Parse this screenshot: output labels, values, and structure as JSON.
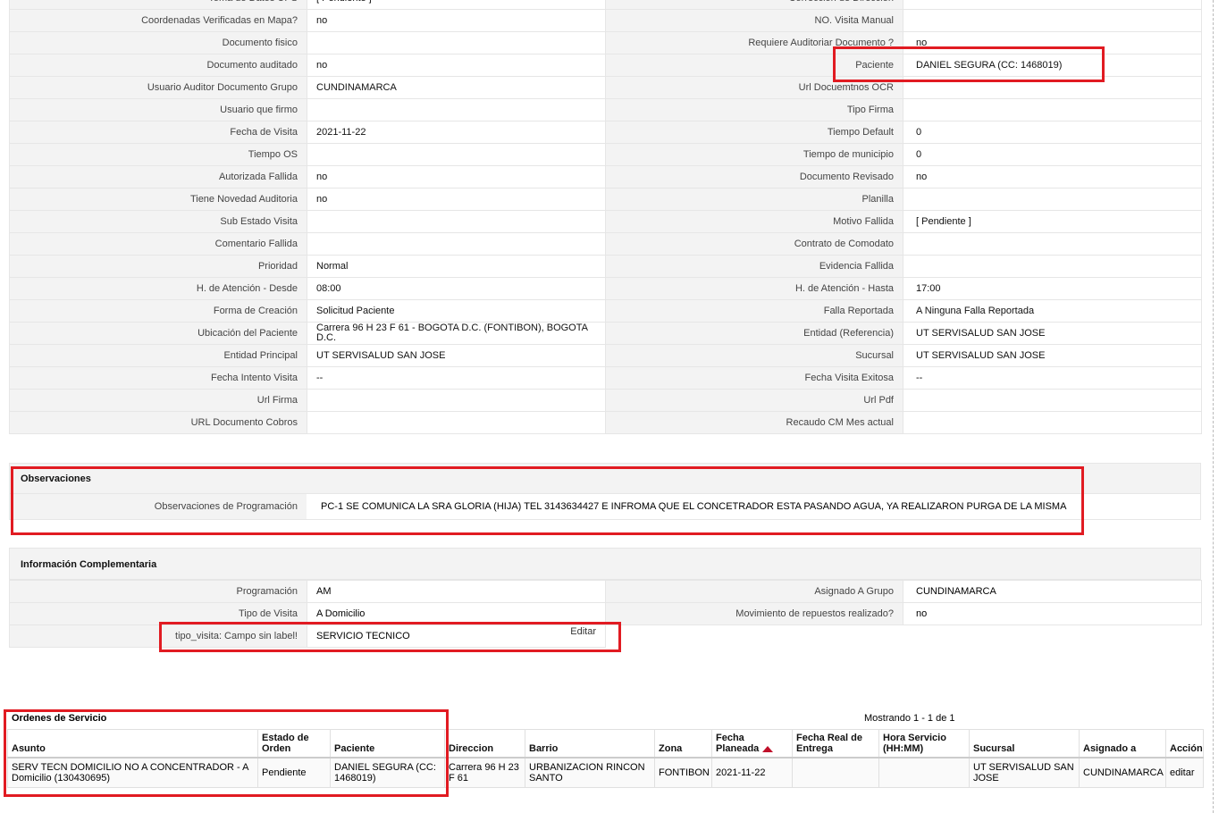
{
  "detail_rows": [
    {
      "l1": "Toma de Datos UPS",
      "v1": "[ Pendiente ]",
      "l2": "Corrección de Dirección",
      "v2": ""
    },
    {
      "l1": "Coordenadas Verificadas en Mapa?",
      "v1": "no",
      "l2": "NO. Visita Manual",
      "v2": ""
    },
    {
      "l1": "Documento fisico",
      "v1": "",
      "l2": "Requiere Auditoriar Documento ?",
      "v2": "no"
    },
    {
      "l1": "Documento auditado",
      "v1": "no",
      "l2": "Paciente",
      "v2": "DANIEL SEGURA (CC: 1468019)"
    },
    {
      "l1": "Usuario Auditor Documento Grupo",
      "v1": "CUNDINAMARCA",
      "l2": "Url Docuemtnos OCR",
      "v2": ""
    },
    {
      "l1": "Usuario que firmo",
      "v1": "",
      "l2": "Tipo Firma",
      "v2": ""
    },
    {
      "l1": "Fecha de Visita",
      "v1": "2021-11-22",
      "l2": "Tiempo Default",
      "v2": "0"
    },
    {
      "l1": "Tiempo OS",
      "v1": "",
      "l2": "Tiempo de municipio",
      "v2": "0"
    },
    {
      "l1": "Autorizada Fallida",
      "v1": "no",
      "l2": "Documento Revisado",
      "v2": "no"
    },
    {
      "l1": "Tiene Novedad Auditoria",
      "v1": "no",
      "l2": "Planilla",
      "v2": ""
    },
    {
      "l1": "Sub Estado Visita",
      "v1": "",
      "l2": "Motivo Fallida",
      "v2": "[ Pendiente ]"
    },
    {
      "l1": "Comentario Fallida",
      "v1": "",
      "l2": "Contrato de Comodato",
      "v2": ""
    },
    {
      "l1": "Prioridad",
      "v1": "Normal",
      "l2": "Evidencia Fallida",
      "v2": ""
    },
    {
      "l1": "H. de Atención - Desde",
      "v1": "08:00",
      "l2": "H. de Atención - Hasta",
      "v2": "17:00"
    },
    {
      "l1": "Forma de Creación",
      "v1": "Solicitud Paciente",
      "l2": "Falla Reportada",
      "v2": "A Ninguna Falla Reportada"
    },
    {
      "l1": "Ubicación del Paciente",
      "v1": "Carrera 96 H 23 F 61 - BOGOTA D.C. (FONTIBON), BOGOTA D.C.",
      "l2": "Entidad (Referencia)",
      "v2": "UT SERVISALUD SAN JOSE"
    },
    {
      "l1": "Entidad Principal",
      "v1": "UT SERVISALUD SAN JOSE",
      "l2": "Sucursal",
      "v2": "UT SERVISALUD SAN JOSE"
    },
    {
      "l1": "Fecha Intento Visita",
      "v1": "--",
      "l2": "Fecha Visita Exitosa",
      "v2": "--"
    },
    {
      "l1": "Url Firma",
      "v1": "",
      "l2": "Url Pdf",
      "v2": ""
    },
    {
      "l1": "URL Documento Cobros",
      "v1": "",
      "l2": "Recaudo CM Mes actual",
      "v2": ""
    }
  ],
  "observaciones": {
    "title": "Observaciones",
    "label": "Observaciones de Programación",
    "value": "PC-1 SE COMUNICA LA SRA GLORIA (HIJA) TEL 3143634427 E INFROMA QUE EL CONCETRADOR ESTA PASANDO AGUA, YA REALIZARON PURGA DE LA MISMA"
  },
  "complementaria": {
    "title": "Información Complementaria",
    "rows": [
      {
        "l1": "Programación",
        "v1": "AM",
        "l2": "Asignado A Grupo",
        "v2": "CUNDINAMARCA"
      },
      {
        "l1": "Tipo de Visita",
        "v1": "A Domicilio",
        "l2": "Movimiento de repuestos realizado?",
        "v2": "no"
      }
    ],
    "tipo_visita_label": "tipo_visita: Campo sin label!",
    "tipo_visita_value": "SERVICIO TECNICO",
    "edit_label": "Editar"
  },
  "ordenes": {
    "title": "Ordenes de Servicio",
    "showing": "Mostrando 1 - 1 de 1",
    "headers": [
      "Asunto",
      "Estado de Orden",
      "Paciente",
      "Direccion",
      "Barrio",
      "Zona",
      "Fecha Planeada",
      "Fecha Real de Entrega",
      "Hora Servicio (HH:MM)",
      "Sucursal",
      "Asignado a",
      "Acción"
    ],
    "row": [
      "SERV TECN DOMICILIO NO A CONCENTRADOR - A Domicilio (130430695)",
      "Pendiente",
      "DANIEL SEGURA (CC: 1468019)",
      "Carrera 96 H 23 F 61",
      "URBANIZACION RINCON SANTO",
      "FONTIBON",
      "2021-11-22",
      "",
      "",
      "UT SERVISALUD SAN JOSE",
      "CUNDINAMARCA",
      "editar"
    ]
  },
  "colors": {
    "highlight": "#e11b22",
    "label_bg": "#f3f3f3",
    "sort_icon": "#c0102a"
  },
  "icons": {
    "sort": "sort-ascending-icon"
  }
}
